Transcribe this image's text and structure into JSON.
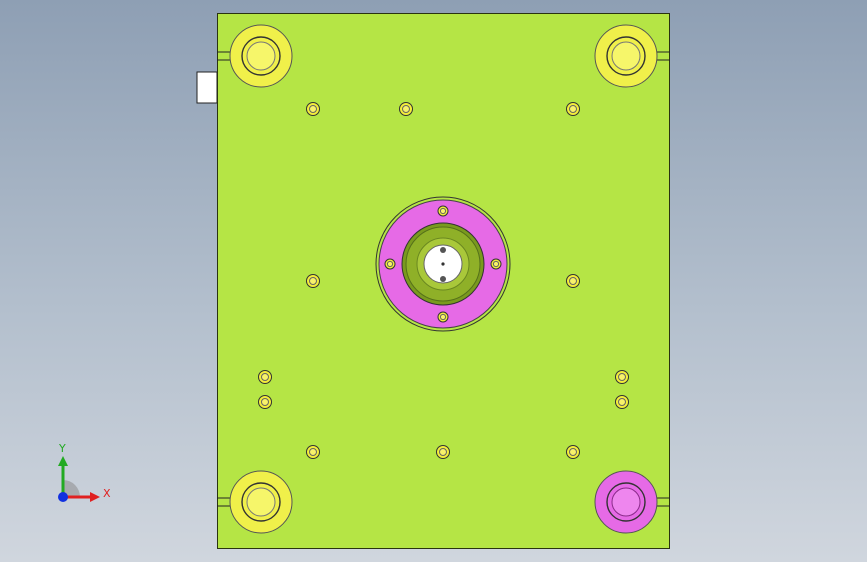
{
  "viewport": {
    "background_top": "#8e9fb4",
    "background_bottom": "#d0d6de"
  },
  "colors": {
    "plate": "#b5e545",
    "plate_edge": "#2a3310",
    "bushing": "#f0f04a",
    "bushing_dark": "#c9c92a",
    "highlight": "#e66ae6",
    "highlight_dark": "#b23cb2",
    "sprue_green": "#7a9a1e",
    "bolt": "#f4ee3a",
    "axis_x": "#e02020",
    "axis_y": "#22aa22",
    "axis_z": "#1030e0"
  },
  "model": {
    "name": "mold-base-top-view",
    "guide_bushings": [
      {
        "id": "top-left",
        "highlighted": false
      },
      {
        "id": "top-right",
        "highlighted": false
      },
      {
        "id": "bottom-left",
        "highlighted": false
      },
      {
        "id": "bottom-right",
        "highlighted": true
      }
    ],
    "bolt_count": 16,
    "locating_ring_screws": 4,
    "locating_ring_highlighted": true
  },
  "triad": {
    "x_label": "X",
    "y_label": "Y",
    "icon": "coordinate-triad-icon"
  }
}
